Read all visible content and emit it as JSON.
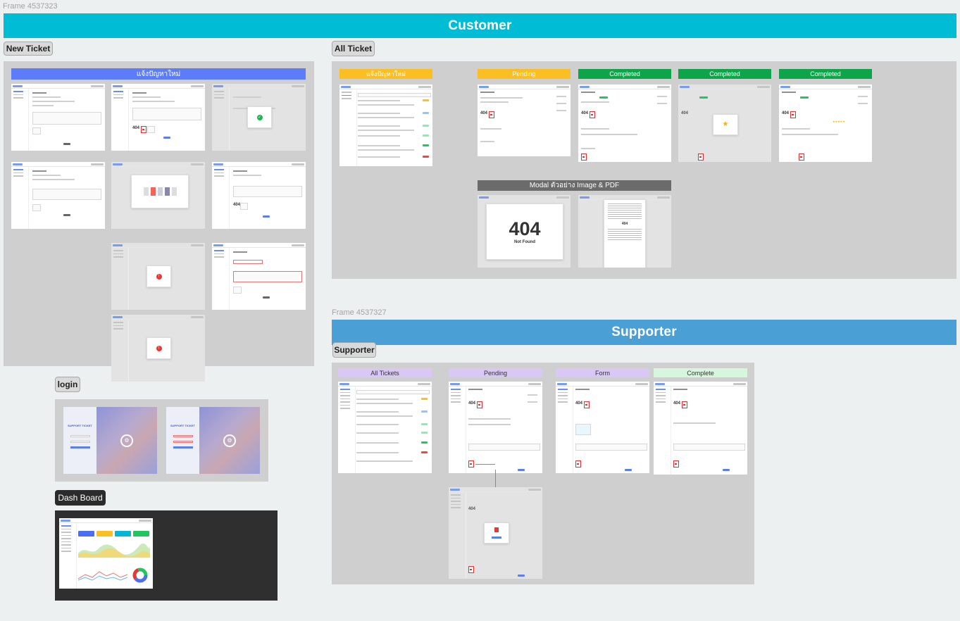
{
  "frames": {
    "main_label": "Frame 4537323",
    "supporter_label": "Frame 4537327"
  },
  "banners": {
    "customer": {
      "label": "Customer",
      "color": "#00bcd4"
    },
    "supporter": {
      "label": "Supporter",
      "color": "#4a9fd5"
    }
  },
  "sections": {
    "new_ticket": {
      "label": "New Ticket",
      "header": "แจ้งปัญหาใหม่",
      "header_color": "#5c7cfa"
    },
    "all_ticket": {
      "label": "All Ticket",
      "columns": [
        {
          "label": "แจ้งปัญหาใหม่",
          "color": "#fbbf24"
        },
        {
          "label": "Pending",
          "color": "#fbbf24"
        },
        {
          "label": "Completed",
          "color": "#0ea44a"
        },
        {
          "label": "Completed",
          "color": "#0ea44a"
        },
        {
          "label": "Completed",
          "color": "#0ea44a"
        }
      ],
      "modal_header": "Modal ตัวอย่าง Image & PDF",
      "modal_header_color": "#6b6b6b",
      "not_found": {
        "code": "404",
        "title": "Not Found"
      }
    },
    "login": {
      "label": "login",
      "brand": "SUPPORT TICKET"
    },
    "dashboard": {
      "label": "Dash Board"
    },
    "supporter": {
      "label": "Supporter",
      "columns": [
        {
          "label": "All Tickets",
          "color": "#d9c8f5"
        },
        {
          "label": "Pending",
          "color": "#d9c8f5"
        },
        {
          "label": "Form",
          "color": "#d9c8f5"
        },
        {
          "label": "Complete",
          "color": "#d7f7dc"
        }
      ]
    }
  },
  "icons": {
    "success": "check-circle-icon",
    "error": "alert-circle-icon",
    "rating": "star-icon",
    "pdf": "pdf-file-icon"
  }
}
